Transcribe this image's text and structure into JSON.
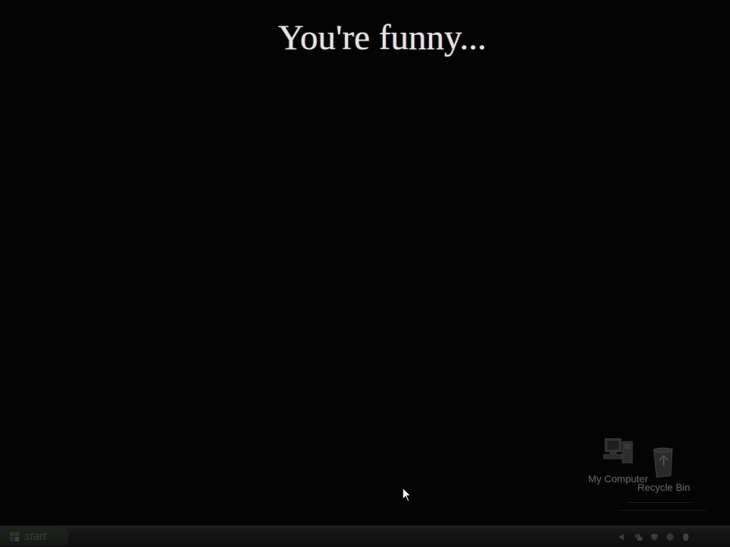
{
  "screen": {
    "headline": "You're funny..."
  },
  "desktop": {
    "icons": [
      {
        "label": "My Computer",
        "icon": "my-computer-icon"
      },
      {
        "label": "Recycle Bin",
        "icon": "recycle-bin-icon"
      }
    ]
  },
  "taskbar": {
    "start_label": "start",
    "tray_icons": [
      "volume-icon",
      "network-icon",
      "security-icon",
      "update-icon",
      "chat-icon"
    ],
    "clock": ""
  },
  "colors": {
    "background": "#030303",
    "headline": "#e4e4e4",
    "faded_label": "#6a6a6a",
    "taskbar": "#121212"
  }
}
